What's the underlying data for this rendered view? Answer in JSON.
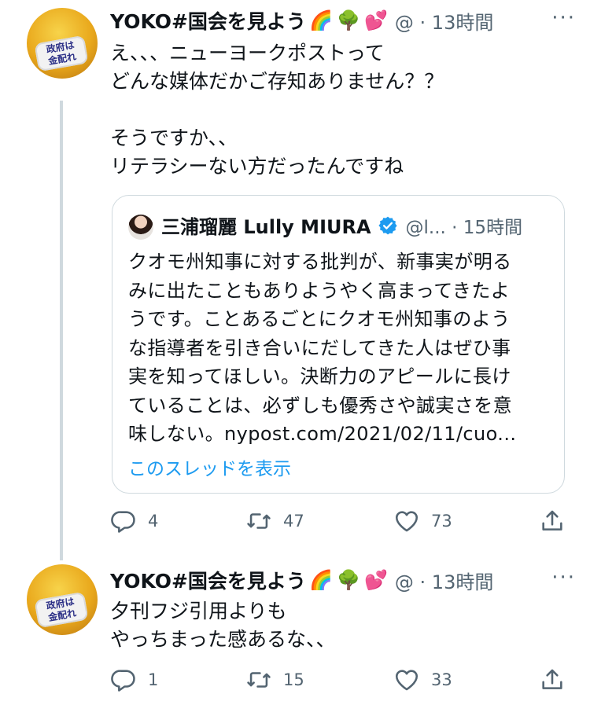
{
  "tweets": [
    {
      "name": "YOKO#国会を見よう",
      "emojis": [
        "🌈",
        "🌳",
        "💕"
      ],
      "handle": "@ · 13時間",
      "avatar_text": "政府は\n金配れ",
      "lines": [
        "え、、、ニューヨークポストって",
        "どんな媒体だかご存知ありません？？",
        "",
        "そうですか、、",
        "リテラシーない方だったんですね"
      ],
      "quote": {
        "name": "三浦瑠麗 Lully MIURA",
        "handle": "@l... · 15時間",
        "lines": [
          "クオモ州知事に対する批判が、新事実が明る",
          "みに出たこともありようやく高まってきたよ",
          "うです。ことあるごとにクオモ州知事のよう",
          "な指導者を引き合いにだしてきた人はぜひ事",
          "実を知ってほしい。決断力のアピールに長け",
          "ていることは、必ずしも優秀さや誠実さを意",
          "味しない。nypost.com/2021/02/11/cuo..."
        ],
        "thread_link": "このスレッドを表示"
      },
      "replies": "4",
      "retweets": "47",
      "likes": "73"
    },
    {
      "name": "YOKO#国会を見よう",
      "emojis": [
        "🌈",
        "🌳",
        "💕"
      ],
      "handle": "@ · 13時間",
      "avatar_text": "政府は\n金配れ",
      "lines": [
        "夕刊フジ引用よりも",
        "やっちまった感あるな、、"
      ],
      "replies": "1",
      "retweets": "15",
      "likes": "33"
    }
  ],
  "colors": {
    "text": "#0f1419",
    "secondary": "#536471",
    "link": "#1d9bf0",
    "border": "#cfd9de",
    "verified": "#1d9bf0"
  },
  "icons": {
    "more": "more-icon",
    "reply": "reply-icon",
    "retweet": "retweet-icon",
    "like": "heart-icon",
    "share": "share-icon",
    "verified": "verified-badge-icon"
  }
}
